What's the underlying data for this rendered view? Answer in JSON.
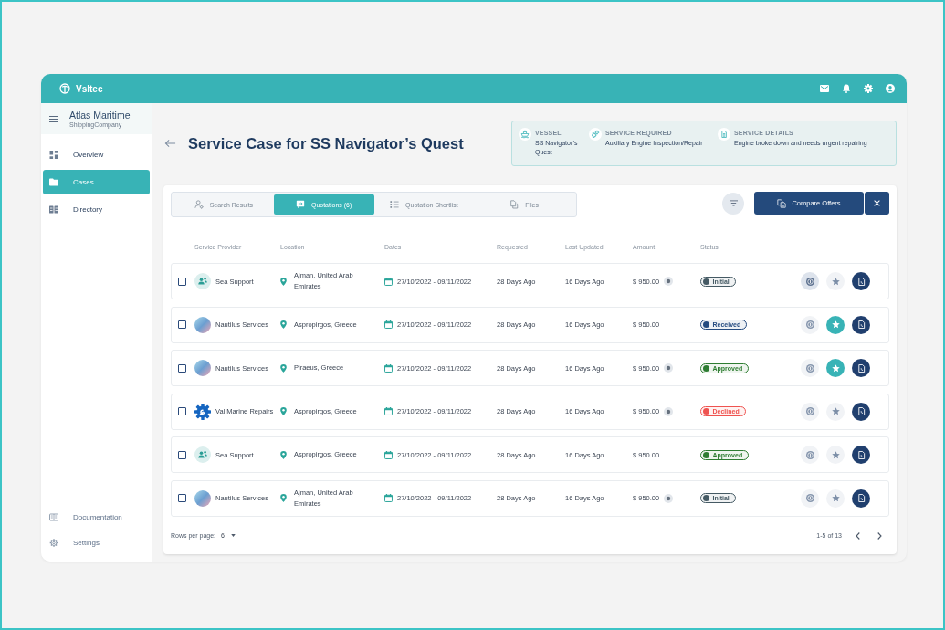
{
  "header": {
    "logo": "Vsltec"
  },
  "sidebar": {
    "company": "Atlas Maritime",
    "company_type": "ShippingCompany",
    "items": [
      {
        "label": "Overview",
        "selected": false
      },
      {
        "label": "Cases",
        "selected": true
      },
      {
        "label": "Directory",
        "selected": false
      }
    ],
    "footer_items": [
      {
        "label": "Documentation"
      },
      {
        "label": "Settings"
      }
    ]
  },
  "page": {
    "title": "Service Case for SS Navigator’s Quest"
  },
  "case_info": [
    {
      "label": "VESSEL",
      "value": "SS Navigator’s Quest"
    },
    {
      "label": "SERVICE REQUIRED",
      "value": "Auxiliary Engine Inspection/Repair"
    },
    {
      "label": "SERVICE DETAILS",
      "value": "Engine broke down and needs urgent repairing"
    }
  ],
  "tabs": [
    {
      "label": "Search Results",
      "selected": false
    },
    {
      "label": "Quotations (6)",
      "selected": true
    },
    {
      "label": "Quotation Shortlist",
      "selected": false
    },
    {
      "label": "Files",
      "selected": false
    }
  ],
  "compare_button": "Compare Offers",
  "table": {
    "columns": [
      "Service Provider",
      "Location",
      "Dates",
      "Requested",
      "Last Updated",
      "Amount",
      "Status"
    ],
    "rows": [
      {
        "checked": false,
        "provider": {
          "name": "Sea Support",
          "kind": "people"
        },
        "location": "Ajman, United Arab Emirates",
        "dates": "27/10/2022 - 09/11/2022",
        "requested": "28 Days Ago",
        "last_updated": "16 Days Ago",
        "amount": "$ 950.00",
        "note": true,
        "status": {
          "label": "Initial",
          "color": "#455a64"
        },
        "quote_selected": true,
        "starred": false
      },
      {
        "checked": false,
        "provider": {
          "name": "Nautilus Services",
          "kind": "photo"
        },
        "location": "Aspropirgos, Greece",
        "dates": "27/10/2022 - 09/11/2022",
        "requested": "28 Days Ago",
        "last_updated": "16 Days Ago",
        "amount": "$ 950.00",
        "note": false,
        "status": {
          "label": "Received",
          "color": "#254b80"
        },
        "quote_selected": false,
        "starred": true
      },
      {
        "checked": false,
        "provider": {
          "name": "Nautilus Services",
          "kind": "photo"
        },
        "location": "Piraeus, Greece",
        "dates": "27/10/2022 - 09/11/2022",
        "requested": "28 Days Ago",
        "last_updated": "16 Days Ago",
        "amount": "$ 950.00",
        "note": true,
        "status": {
          "label": "Approved",
          "color": "#2e7d32"
        },
        "quote_selected": false,
        "starred": true
      },
      {
        "checked": false,
        "provider": {
          "name": "Val Marine Repairs",
          "kind": "gear"
        },
        "location": "Aspropirgos, Greece",
        "dates": "27/10/2022 - 09/11/2022",
        "requested": "28 Days Ago",
        "last_updated": "16 Days Ago",
        "amount": "$ 950.00",
        "note": true,
        "status": {
          "label": "Declined",
          "color": "#ef5350"
        },
        "quote_selected": false,
        "starred": false
      },
      {
        "checked": false,
        "provider": {
          "name": "Sea Support",
          "kind": "people"
        },
        "location": "Aspropirgos, Greece",
        "dates": "27/10/2022 - 09/11/2022",
        "requested": "28 Days Ago",
        "last_updated": "16 Days Ago",
        "amount": "$ 950.00",
        "note": false,
        "status": {
          "label": "Approved",
          "color": "#2e7d32"
        },
        "quote_selected": false,
        "starred": false
      },
      {
        "checked": false,
        "provider": {
          "name": "Nautilus Services",
          "kind": "photo"
        },
        "location": "Ajman, United Arab Emirates",
        "dates": "27/10/2022 - 09/11/2022",
        "requested": "28 Days Ago",
        "last_updated": "16 Days Ago",
        "amount": "$ 950.00",
        "note": true,
        "status": {
          "label": "Initial",
          "color": "#455a64"
        },
        "quote_selected": false,
        "starred": false
      }
    ]
  },
  "pagination": {
    "rows_per_page_label": "Rows per page:",
    "rows_per_page": "6",
    "range": "1-5 of 13"
  }
}
